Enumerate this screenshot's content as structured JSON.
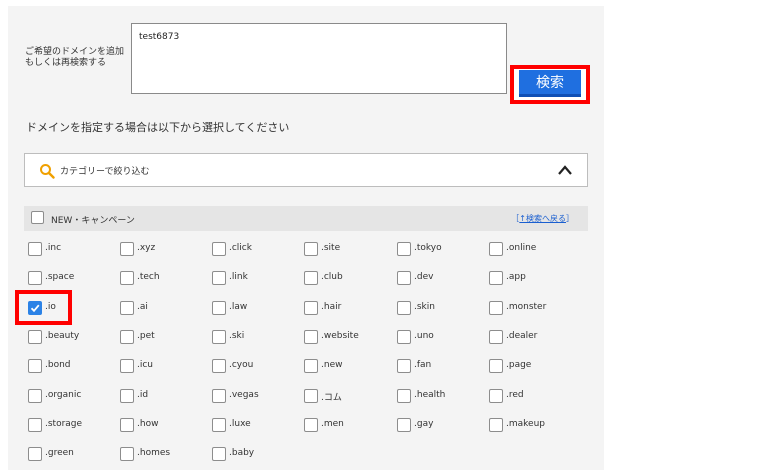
{
  "search": {
    "label": "ご希望のドメインを追加\nもしくは再検索する",
    "value": "test6873",
    "button_label": "検索"
  },
  "instruction": "ドメインを指定する場合は以下から選択してください",
  "filter": {
    "text": "カテゴリーで絞り込む",
    "icon": "search-icon",
    "toggle_icon": "chevron-up-icon"
  },
  "category": {
    "label": "NEW・キャンペーン",
    "back_link": "［↑検索へ戻る］",
    "back_link_text": "↑検索へ戻る"
  },
  "tld_rows": [
    [
      ".inc",
      ".xyz",
      ".click",
      ".site",
      ".tokyo",
      ".online"
    ],
    [
      ".space",
      ".tech",
      ".link",
      ".club",
      ".dev",
      ".app"
    ],
    [
      ".io",
      ".ai",
      ".law",
      ".hair",
      ".skin",
      ".monster"
    ],
    [
      ".beauty",
      ".pet",
      ".ski",
      ".website",
      ".uno",
      ".dealer"
    ],
    [
      ".bond",
      ".icu",
      ".cyou",
      ".new",
      ".fan",
      ".page"
    ],
    [
      ".organic",
      ".id",
      ".vegas",
      ".コム",
      ".health",
      ".red"
    ],
    [
      ".storage",
      ".how",
      ".luxe",
      ".men",
      ".gay",
      ".makeup"
    ],
    [
      ".green",
      ".homes",
      ".baby"
    ]
  ],
  "checked": [
    ".io"
  ],
  "colors": {
    "accent": "#1f6fe0",
    "highlight": "#ff0000",
    "checkbox_checked": "#2b82e6",
    "search_icon": "#f0a000"
  }
}
